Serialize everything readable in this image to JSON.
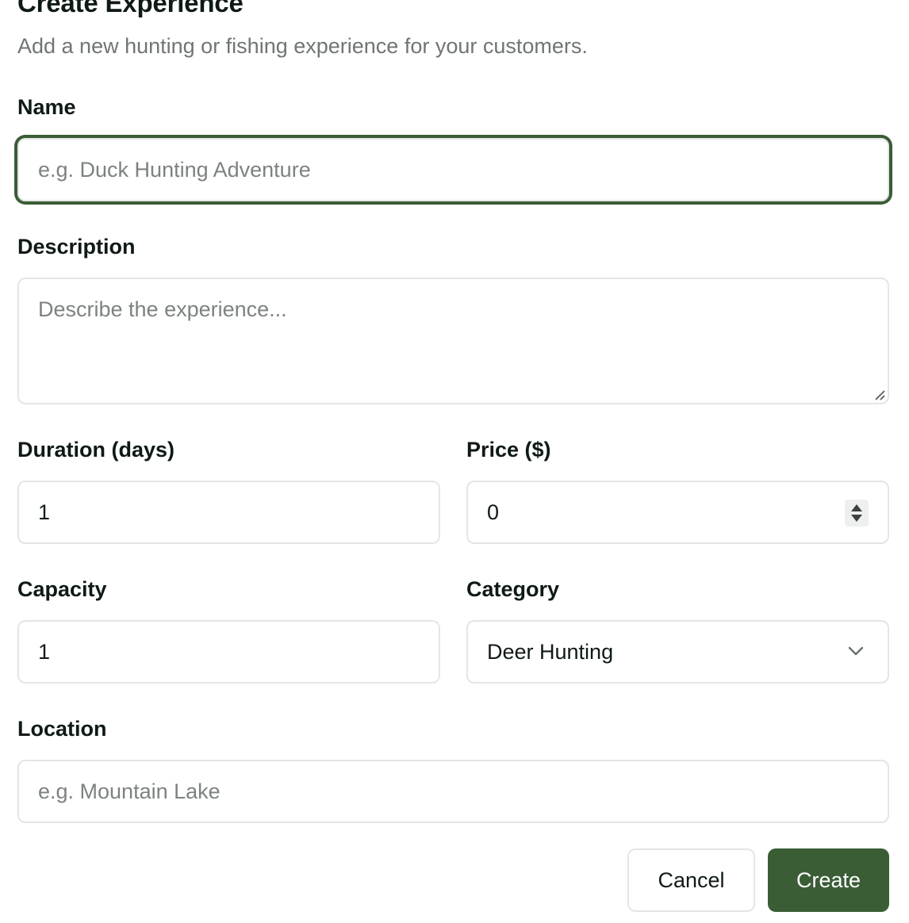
{
  "dialog": {
    "title": "Create Experience",
    "subtitle": "Add a new hunting or fishing experience for your customers."
  },
  "form": {
    "name": {
      "label": "Name",
      "placeholder": "e.g. Duck Hunting Adventure",
      "value": ""
    },
    "description": {
      "label": "Description",
      "placeholder": "Describe the experience...",
      "value": ""
    },
    "duration": {
      "label": "Duration (days)",
      "value": "1"
    },
    "price": {
      "label": "Price ($)",
      "value": "0"
    },
    "capacity": {
      "label": "Capacity",
      "value": "1"
    },
    "category": {
      "label": "Category",
      "selected": "Deer Hunting"
    },
    "location": {
      "label": "Location",
      "placeholder": "e.g. Mountain Lake",
      "value": ""
    }
  },
  "actions": {
    "cancel_label": "Cancel",
    "create_label": "Create"
  },
  "colors": {
    "accent": "#3a5d36",
    "border": "#e3e6e4",
    "muted_text": "#6f7672",
    "text": "#0f1a14"
  },
  "icons": {
    "select": "chevron-down-icon",
    "price_stepper": "spinner-icon",
    "textarea_resize": "resize-handle-icon"
  }
}
